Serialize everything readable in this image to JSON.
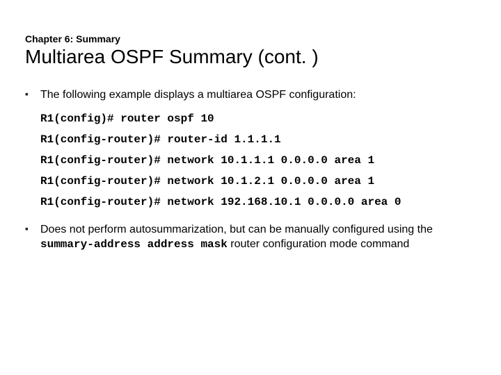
{
  "header": {
    "chapter": "Chapter 6: Summary",
    "title": "Multiarea OSPF Summary (cont. )"
  },
  "bullets": [
    {
      "text": "The following example displays a multiarea OSPF configuration:",
      "config": [
        "R1(config)# router ospf 10",
        "R1(config-router)# router-id 1.1.1.1",
        "R1(config-router)# network 10.1.1.1 0.0.0.0 area 1",
        "R1(config-router)# network 10.1.2.1 0.0.0.0 area 1",
        "R1(config-router)# network 192.168.10.1 0.0.0.0 area 0"
      ]
    },
    {
      "text_before": "Does not perform autosummarization, but can be manually configured using the ",
      "code": "summary-address address mask",
      "text_after": " router configuration mode command"
    }
  ]
}
